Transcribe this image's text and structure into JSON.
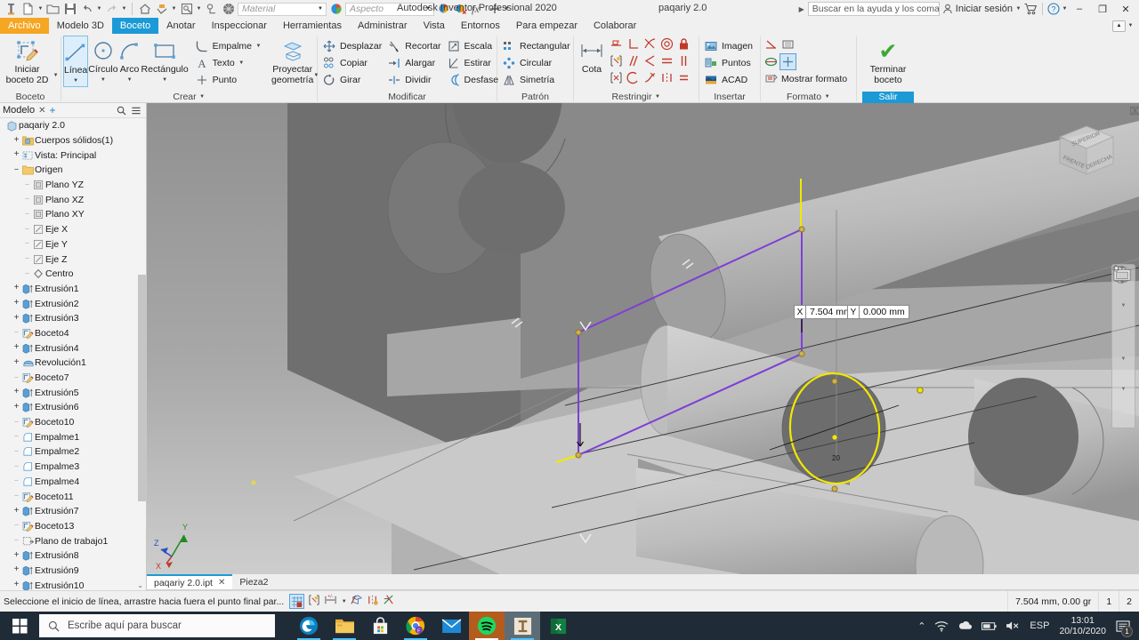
{
  "titlebar": {
    "app_title": "Autodesk Inventor Professional 2020",
    "doc_name": "paqariy 2.0",
    "search_placeholder": "Buscar en la ayuda y los comandos",
    "sign_in": "Iniciar sesión",
    "material_placeholder": "Material",
    "appearance_placeholder": "Aspecto",
    "minimize": "–",
    "restore": "❐",
    "close": "✕"
  },
  "ribbon_tabs": [
    {
      "label": "Archivo",
      "style": "file"
    },
    {
      "label": "Modelo 3D",
      "style": "normal"
    },
    {
      "label": "Boceto",
      "style": "active"
    },
    {
      "label": "Anotar",
      "style": "normal"
    },
    {
      "label": "Inspeccionar",
      "style": "normal"
    },
    {
      "label": "Herramientas",
      "style": "normal"
    },
    {
      "label": "Administrar",
      "style": "normal"
    },
    {
      "label": "Vista",
      "style": "normal"
    },
    {
      "label": "Entornos",
      "style": "normal"
    },
    {
      "label": "Para empezar",
      "style": "normal"
    },
    {
      "label": "Colaborar",
      "style": "normal"
    }
  ],
  "ribbon": {
    "panel_boceto": {
      "title": "Boceto",
      "start_sketch": "Iniciar\nboceto 2D",
      "start_sketch_l1": "Iniciar",
      "start_sketch_l2": "boceto 2D"
    },
    "panel_crear": {
      "title": "Crear",
      "linea": "Línea",
      "circulo": "Círculo",
      "arco": "Arco",
      "rectangulo": "Rectángulo",
      "empalme": "Empalme",
      "texto": "Texto",
      "punto": "Punto",
      "proyectar_l1": "Proyectar",
      "proyectar_l2": "geometría"
    },
    "panel_modificar": {
      "title": "Modificar",
      "desplazar": "Desplazar",
      "copiar": "Copiar",
      "girar": "Girar",
      "recortar": "Recortar",
      "alargar": "Alargar",
      "dividir": "Dividir",
      "escala": "Escala",
      "estirar": "Estirar",
      "desfase": "Desfase"
    },
    "panel_patron": {
      "title": "Patrón",
      "rectangular": "Rectangular",
      "circular": "Circular",
      "simetria": "Simetría"
    },
    "panel_restringir": {
      "title": "Restringir",
      "cota": "Cota"
    },
    "panel_insertar": {
      "title": "Insertar",
      "imagen": "Imagen",
      "puntos": "Puntos",
      "acad": "ACAD"
    },
    "panel_formato": {
      "title": "Formato",
      "mostrar_formato": "Mostrar formato"
    },
    "panel_salir": {
      "terminar_l1": "Terminar",
      "terminar_l2": "boceto",
      "salir": "Salir"
    }
  },
  "browser": {
    "tab_label": "Modelo",
    "close": "✕",
    "add": "+",
    "search_icon": "search-icon",
    "menu_icon": "hamburger-icon",
    "root": "paqariy 2.0",
    "items": [
      {
        "label": "Cuerpos sólidos(1)",
        "indent": 1,
        "expander": "+",
        "icon": "folder-body"
      },
      {
        "label": "Vista: Principal",
        "indent": 1,
        "expander": "+",
        "icon": "view"
      },
      {
        "label": "Origen",
        "indent": 1,
        "expander": "–",
        "icon": "folder"
      },
      {
        "label": "Plano YZ",
        "indent": 2,
        "expander": "",
        "icon": "plane"
      },
      {
        "label": "Plano XZ",
        "indent": 2,
        "expander": "",
        "icon": "plane"
      },
      {
        "label": "Plano XY",
        "indent": 2,
        "expander": "",
        "icon": "plane"
      },
      {
        "label": "Eje X",
        "indent": 2,
        "expander": "",
        "icon": "axis"
      },
      {
        "label": "Eje Y",
        "indent": 2,
        "expander": "",
        "icon": "axis"
      },
      {
        "label": "Eje Z",
        "indent": 2,
        "expander": "",
        "icon": "axis"
      },
      {
        "label": "Centro",
        "indent": 2,
        "expander": "",
        "icon": "center"
      },
      {
        "label": "Extrusión1",
        "indent": 1,
        "expander": "+",
        "icon": "extrude"
      },
      {
        "label": "Extrusión2",
        "indent": 1,
        "expander": "+",
        "icon": "extrude"
      },
      {
        "label": "Extrusión3",
        "indent": 1,
        "expander": "+",
        "icon": "extrude"
      },
      {
        "label": "Boceto4",
        "indent": 1,
        "expander": "",
        "icon": "sketch"
      },
      {
        "label": "Extrusión4",
        "indent": 1,
        "expander": "+",
        "icon": "extrude"
      },
      {
        "label": "Revolución1",
        "indent": 1,
        "expander": "+",
        "icon": "revolve"
      },
      {
        "label": "Boceto7",
        "indent": 1,
        "expander": "",
        "icon": "sketch"
      },
      {
        "label": "Extrusión5",
        "indent": 1,
        "expander": "+",
        "icon": "extrude"
      },
      {
        "label": "Extrusión6",
        "indent": 1,
        "expander": "+",
        "icon": "extrude"
      },
      {
        "label": "Boceto10",
        "indent": 1,
        "expander": "",
        "icon": "sketch"
      },
      {
        "label": "Empalme1",
        "indent": 1,
        "expander": "",
        "icon": "fillet"
      },
      {
        "label": "Empalme2",
        "indent": 1,
        "expander": "",
        "icon": "fillet"
      },
      {
        "label": "Empalme3",
        "indent": 1,
        "expander": "",
        "icon": "fillet"
      },
      {
        "label": "Empalme4",
        "indent": 1,
        "expander": "",
        "icon": "fillet"
      },
      {
        "label": "Boceto11",
        "indent": 1,
        "expander": "",
        "icon": "sketch"
      },
      {
        "label": "Extrusión7",
        "indent": 1,
        "expander": "+",
        "icon": "extrude"
      },
      {
        "label": "Boceto13",
        "indent": 1,
        "expander": "",
        "icon": "sketch"
      },
      {
        "label": "Plano de trabajo1",
        "indent": 1,
        "expander": "",
        "icon": "workplane"
      },
      {
        "label": "Extrusión8",
        "indent": 1,
        "expander": "+",
        "icon": "extrude"
      },
      {
        "label": "Extrusión9",
        "indent": 1,
        "expander": "+",
        "icon": "extrude"
      },
      {
        "label": "Extrusión10",
        "indent": 1,
        "expander": "+",
        "icon": "extrude"
      }
    ]
  },
  "viewport": {
    "dim_x_label": "X",
    "dim_x_value": "7.504 mm",
    "dim_y_label": "Y",
    "dim_y_value": "0.000 mm",
    "circle_dim_text": "20",
    "axis_x": "X",
    "axis_y": "Y",
    "axis_z": "Z",
    "viewcube_top": "SUPERIOR",
    "viewcube_front": "FRENTE",
    "viewcube_right": "DERECHA",
    "colors": {
      "sketch_line": "#7d3fd6",
      "sketch_highlight": "#f2e800",
      "background_top": "#8f8f8f",
      "background_bottom": "#c9c9c9"
    }
  },
  "doc_tabs": [
    {
      "label": "paqariy 2.0.ipt",
      "active": true,
      "close": "✕"
    },
    {
      "label": "Pieza2",
      "active": false,
      "close": ""
    }
  ],
  "status": {
    "message": "Seleccione el inicio de línea, arrastre hacia fuera el punto final par...",
    "coord_readout": "7.504 mm, 0.00 gr",
    "cell1": "1",
    "cell2": "2"
  },
  "taskbar": {
    "search_placeholder": "Escribe aquí para buscar",
    "language": "ESP",
    "time": "13:01",
    "date": "20/10/2020",
    "notification_count": "1",
    "apps": [
      "edge-icon",
      "file-explorer-icon",
      "microsoft-store-icon",
      "chrome-icon",
      "mail-icon",
      "spotify-icon",
      "inventor-icon",
      "excel-icon"
    ]
  }
}
